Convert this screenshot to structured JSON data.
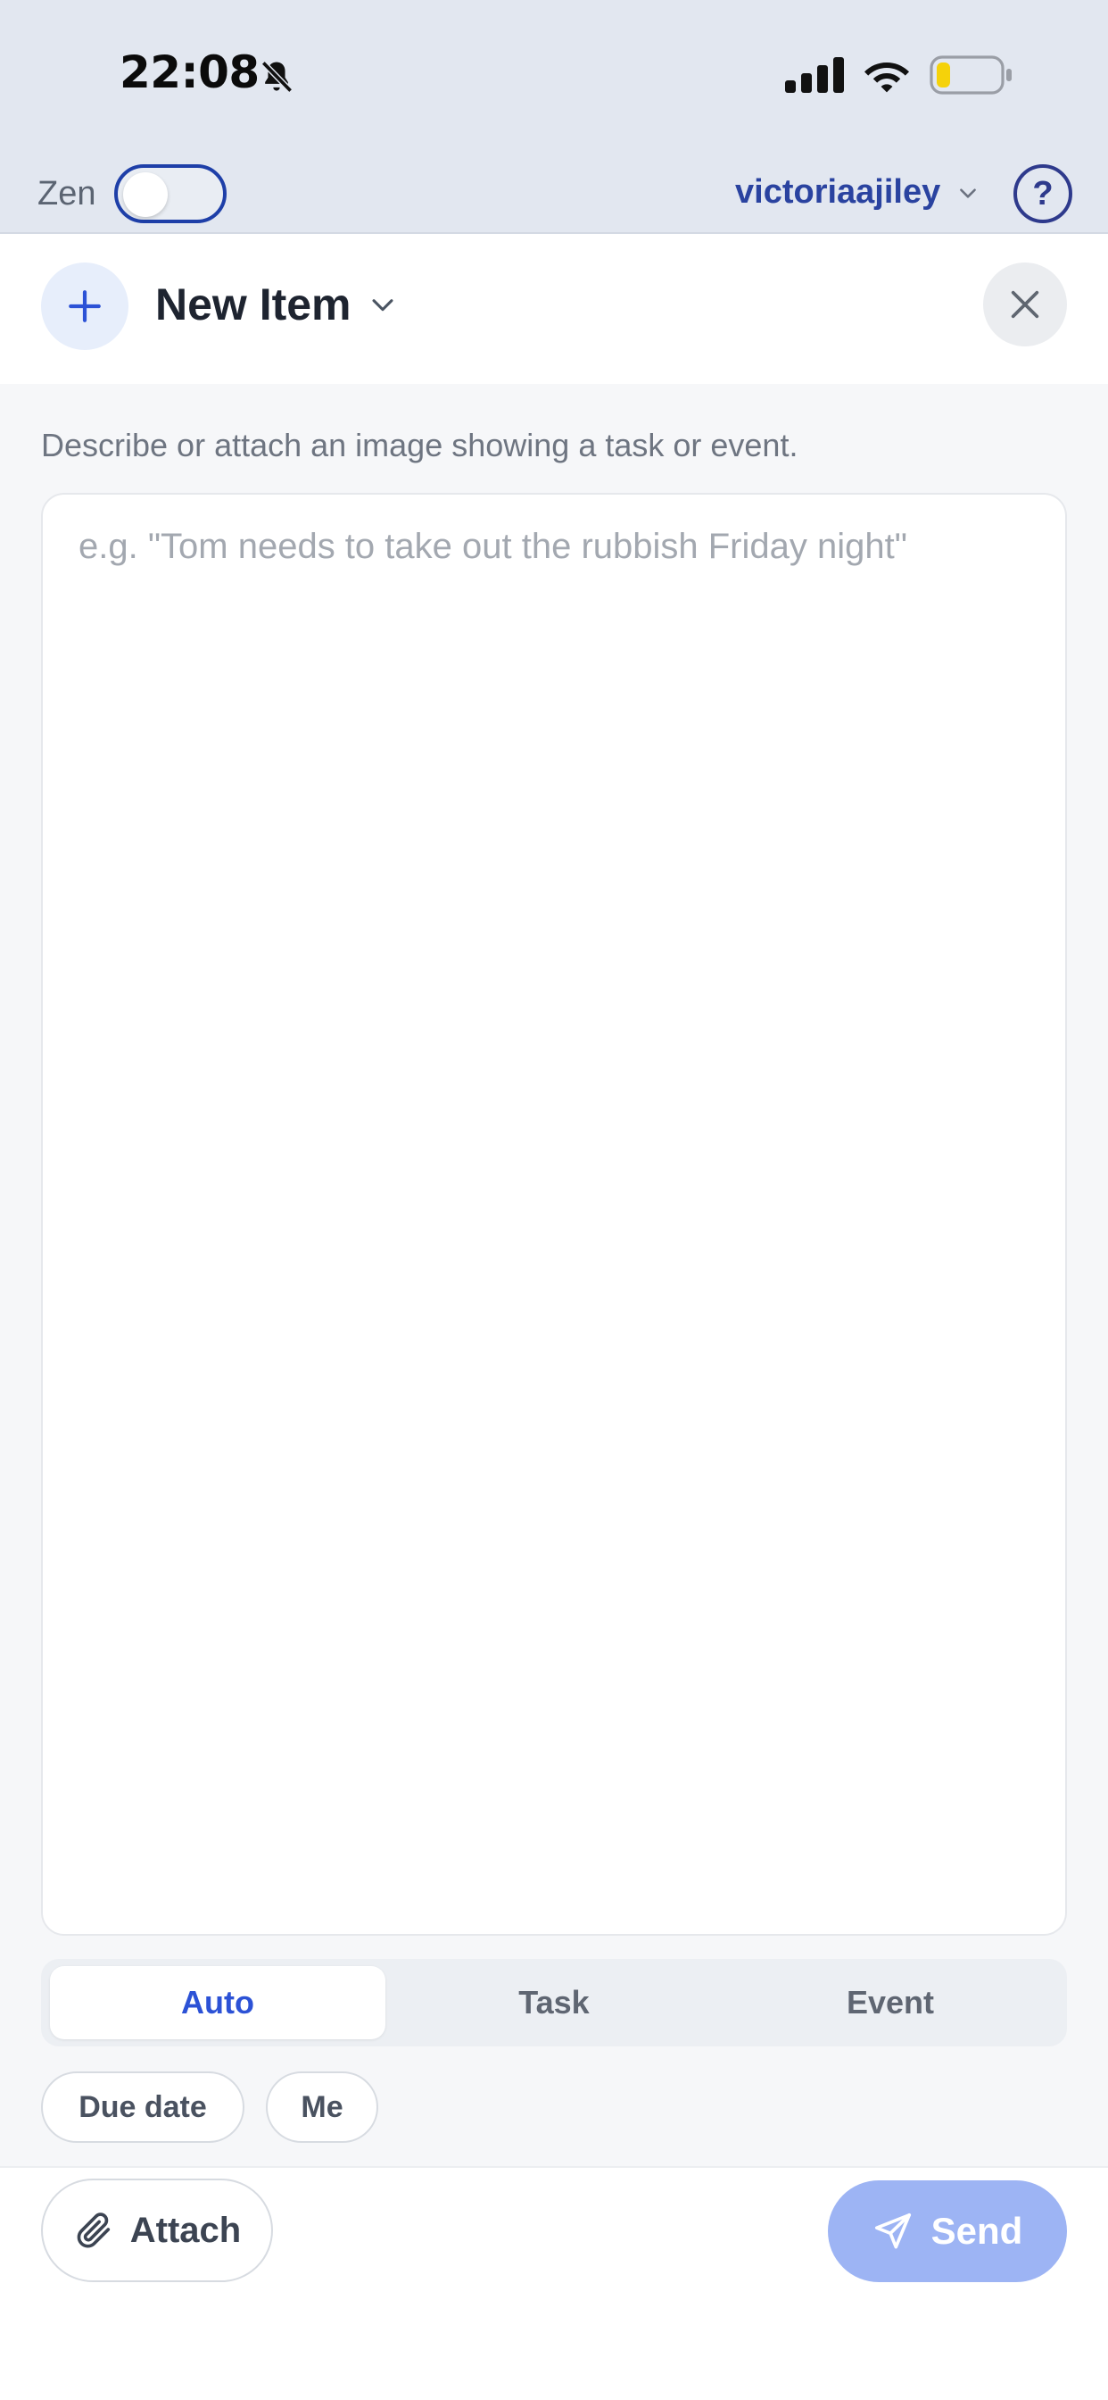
{
  "status_bar": {
    "time": "22:08",
    "icons": [
      "bell-slash-icon",
      "cellular-signal-icon",
      "wifi-icon",
      "battery-low-icon"
    ],
    "battery_color": "#f5d20a"
  },
  "app_bar": {
    "zen_label": "Zen",
    "zen_enabled": false,
    "account_name": "victoriaajiley",
    "help_label": "?"
  },
  "header": {
    "title": "New Item"
  },
  "composer": {
    "hint": "Describe or attach an image showing a task or event.",
    "placeholder": "e.g. \"Tom needs to take out the rubbish Friday night\"",
    "value": ""
  },
  "type_selector": {
    "options": [
      "Auto",
      "Task",
      "Event"
    ],
    "selected": "Auto"
  },
  "chips": {
    "due_date": "Due date",
    "assignee": "Me"
  },
  "footer": {
    "attach_label": "Attach",
    "send_label": "Send"
  },
  "colors": {
    "accent": "#2c52d6",
    "account_text": "#2a43a0",
    "send_disabled": "#9db4f4",
    "top_background": "#e2e7f0"
  }
}
